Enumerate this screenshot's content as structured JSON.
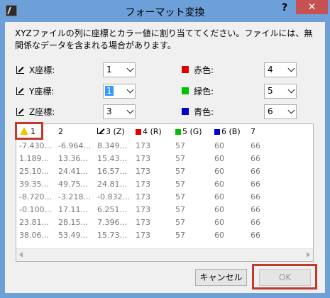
{
  "window": {
    "title": "フォーマット変換",
    "help": "?",
    "close": "✕"
  },
  "description": "XYZファイルの列に座標とカラー値に割り当ててください。ファイルには、無関係なデータを含まれる場合があります。",
  "mapping": {
    "x": {
      "label": "X座標:",
      "value": "1"
    },
    "y": {
      "label": "Y座標:",
      "value": "1"
    },
    "z": {
      "label": "Z座標:",
      "value": "3"
    },
    "red": {
      "label": "赤色:",
      "value": "4",
      "color": "#e00000"
    },
    "green": {
      "label": "緑色:",
      "value": "5",
      "color": "#00c000"
    },
    "blue": {
      "label": "青色:",
      "value": "6",
      "color": "#0000c8"
    }
  },
  "table": {
    "headers": [
      "1",
      "2",
      "3 (Z)",
      "4 (R)",
      "5 (G)",
      "6 (B)",
      "7"
    ],
    "rows": [
      [
        "-7.430...",
        "-6.964...",
        "8.349...",
        "173",
        "57",
        "60",
        "66"
      ],
      [
        "1.189...",
        "13.36...",
        "15.43...",
        "173",
        "57",
        "60",
        "66"
      ],
      [
        "25.10...",
        "24.41...",
        "16.57...",
        "173",
        "57",
        "60",
        "66"
      ],
      [
        "39.35...",
        "49.75...",
        "24.81...",
        "173",
        "57",
        "60",
        "66"
      ],
      [
        "-8.720...",
        "-3.218...",
        "-0.832...",
        "173",
        "57",
        "60",
        "66"
      ],
      [
        "-0.100...",
        "17.11...",
        "6.251...",
        "173",
        "57",
        "60",
        "66"
      ],
      [
        "23.81...",
        "28.15...",
        "7.396...",
        "173",
        "57",
        "60",
        "66"
      ],
      [
        "38.06...",
        "53.49...",
        "15.73...",
        "173",
        "57",
        "60",
        "66"
      ]
    ]
  },
  "buttons": {
    "cancel": "キャンセル",
    "ok": "OK"
  }
}
